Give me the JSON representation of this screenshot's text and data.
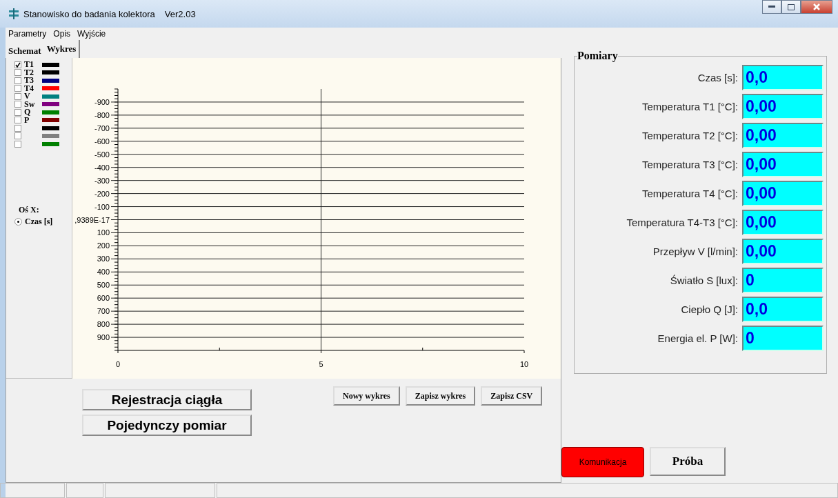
{
  "window": {
    "title": "Stanowisko do badania kolektora",
    "version": "Ver2.03"
  },
  "menu": [
    "Parametry",
    "Opis",
    "Wyjście"
  ],
  "tabs": [
    {
      "label": "Schemat",
      "selected": false
    },
    {
      "label": "Wykres",
      "selected": true
    }
  ],
  "series_toggles": [
    {
      "label": "T1",
      "checked": true,
      "color": "#000000"
    },
    {
      "label": "T2",
      "checked": false,
      "color": "#000000"
    },
    {
      "label": "T3",
      "checked": false,
      "color": "#000080"
    },
    {
      "label": "T4",
      "checked": false,
      "color": "#ff0000"
    },
    {
      "label": "V",
      "checked": false,
      "color": "#008080"
    },
    {
      "label": "Sw",
      "checked": false,
      "color": "#800080"
    },
    {
      "label": "Q",
      "checked": false,
      "color": "#008000"
    },
    {
      "label": "P",
      "checked": false,
      "color": "#800000"
    },
    {
      "checked": false,
      "color": "#000000"
    },
    {
      "checked": false,
      "color": "#808080"
    },
    {
      "checked": false,
      "color": "#008000"
    }
  ],
  "x_axis": {
    "label": "Oś X:",
    "options": [
      {
        "label": "Czas [s]",
        "selected": true
      }
    ]
  },
  "chart": {
    "chart_data": {
      "type": "line",
      "grid": true,
      "xlim": [
        0,
        10
      ],
      "ylim": [
        1000,
        -1000
      ],
      "xticks": [
        0,
        5,
        10
      ],
      "yticks": [
        -900,
        -800,
        -700,
        -600,
        -500,
        -400,
        -300,
        -200,
        -100,
        {
          "value": 0,
          "label": ",9389E-17"
        },
        100,
        200,
        300,
        400,
        500,
        600,
        700,
        800,
        900
      ]
    }
  },
  "chart_buttons": [
    "Nowy wykres",
    "Zapisz wykres",
    "Zapisz CSV"
  ],
  "measure_buttons": [
    "Rejestracja ciągła",
    "Pojedynczy pomiar"
  ],
  "measurements": {
    "title": "Pomiary",
    "rows": [
      {
        "label": "Czas [s]:",
        "value": "0,0"
      },
      {
        "label": "Temperatura T1 [°C]:",
        "value": "0,00"
      },
      {
        "label": "Temperatura T2 [°C]:",
        "value": "0,00"
      },
      {
        "label": "Temperatura T3 [°C]:",
        "value": "0,00"
      },
      {
        "label": "Temperatura T4 [°C]:",
        "value": "0,00"
      },
      {
        "label": "Temperatura T4-T3 [°C]:",
        "value": "0,00"
      },
      {
        "label": "Przepływ V [l/min]:",
        "value": "0,00"
      },
      {
        "label": "Światło S [lux]:",
        "value": "0"
      },
      {
        "label": "Ciepło Q [J]:",
        "value": "0,0"
      },
      {
        "label": "Energia el. P [W]:",
        "value": "0"
      }
    ]
  },
  "actions": [
    {
      "label": "Komunikacja",
      "kind": "alert"
    },
    {
      "label": "Próba",
      "kind": "normal"
    }
  ]
}
